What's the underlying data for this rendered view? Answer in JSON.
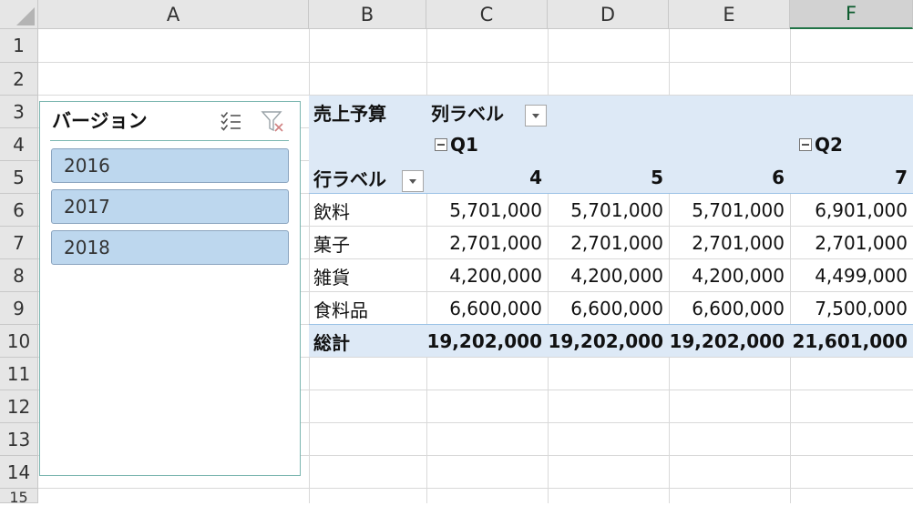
{
  "grid": {
    "columns": [
      "A",
      "B",
      "C",
      "D",
      "E",
      "F"
    ],
    "rows": [
      "1",
      "2",
      "3",
      "4",
      "5",
      "6",
      "7",
      "8",
      "9",
      "10",
      "11",
      "12",
      "13",
      "14",
      "15"
    ]
  },
  "slicer": {
    "title": "バージョン",
    "items": [
      "2016",
      "2017",
      "2018"
    ]
  },
  "pivot": {
    "value_field": "売上予算",
    "col_label": "列ラベル",
    "row_label": "行ラベル",
    "groups": [
      "Q1",
      "Q2"
    ],
    "months": [
      "4",
      "5",
      "6",
      "7"
    ],
    "rows": [
      {
        "label": "飲料",
        "values": [
          "5,701,000",
          "5,701,000",
          "5,701,000",
          "6,901,000"
        ]
      },
      {
        "label": "菓子",
        "values": [
          "2,701,000",
          "2,701,000",
          "2,701,000",
          "2,701,000"
        ]
      },
      {
        "label": "雑貨",
        "values": [
          "4,200,000",
          "4,200,000",
          "4,200,000",
          "4,499,000"
        ]
      },
      {
        "label": "食料品",
        "values": [
          "6,600,000",
          "6,600,000",
          "6,600,000",
          "7,500,000"
        ]
      }
    ],
    "total": {
      "label": "総計",
      "values": [
        "19,202,000",
        "19,202,000",
        "19,202,000",
        "21,601,000"
      ]
    }
  },
  "colors": {
    "accent": "#217346",
    "pivot_band": "#dde9f6",
    "slicer_item": "#bdd7ee"
  }
}
